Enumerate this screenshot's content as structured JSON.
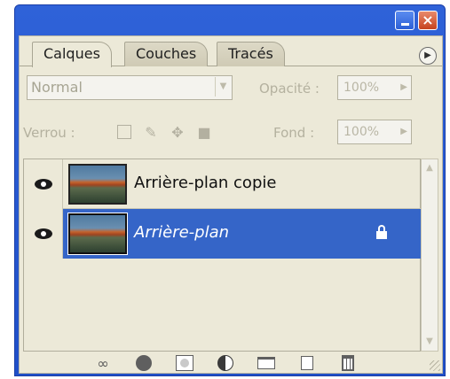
{
  "window": {
    "controls": {
      "minimize": "minimize-icon",
      "close": "×"
    }
  },
  "tabs": [
    {
      "label": "Calques",
      "active": true
    },
    {
      "label": "Couches",
      "active": false
    },
    {
      "label": "Tracés",
      "active": false
    }
  ],
  "panel_menu_icon": "▶",
  "blend": {
    "mode": "Normal",
    "opacity_label": "Opacité :",
    "opacity_value": "100%"
  },
  "lock": {
    "label": "Verrou :",
    "fill_label": "Fond :",
    "fill_value": "100%"
  },
  "layers": [
    {
      "name": "Arrière-plan copie",
      "visible": true,
      "selected": false,
      "locked": false
    },
    {
      "name": "Arrière-plan",
      "visible": true,
      "selected": true,
      "locked": true
    }
  ],
  "colors": {
    "selection": "#3565c8",
    "panel_bg": "#ece9d8",
    "title_bar": "#2f62d8"
  }
}
